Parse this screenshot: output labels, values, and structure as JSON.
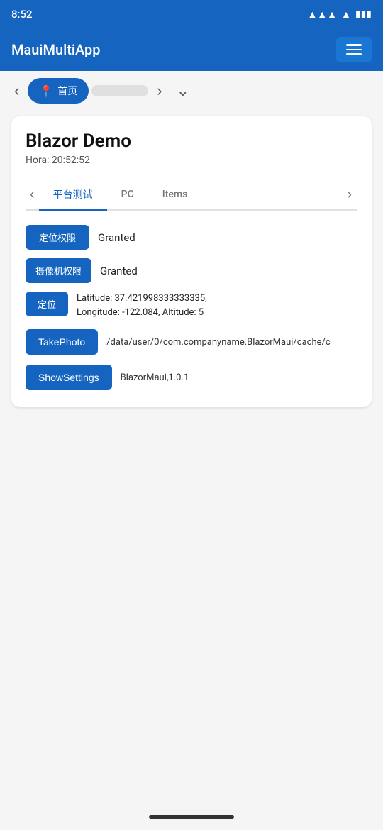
{
  "statusBar": {
    "time": "8:52",
    "wifiIcon": "📶",
    "signalIcon": "▲",
    "batteryIcon": "🔋"
  },
  "appBar": {
    "title": "MauiMultiApp",
    "menuIcon": "menu"
  },
  "tabNav": {
    "backArrow": "‹",
    "homeTab": {
      "icon": "📍",
      "label": "首页"
    },
    "blankTab": "",
    "forwardArrow": "›",
    "moreArrow": "⌄"
  },
  "page": {
    "title": "Blazor Demo",
    "subtitle": "Hora: 20:52:52"
  },
  "innerTabs": {
    "backArrow": "‹",
    "tabs": [
      {
        "label": "平台测试",
        "active": true
      },
      {
        "label": "PC",
        "active": false
      },
      {
        "label": "Items",
        "active": false
      }
    ],
    "moreArrow": "›"
  },
  "permissions": [
    {
      "badge": "定位权限",
      "status": "Granted"
    },
    {
      "badge": "摄像机权限",
      "status": "Granted"
    }
  ],
  "location": {
    "badge": "定位",
    "lat": "Latitude: 37.421998333333335,",
    "details": "Longitude: -122.084, Altitude: 5"
  },
  "actions": [
    {
      "button": "TakePhoto",
      "text": "/data/user/0/com.companyname.BlazorMaui/cache/c"
    },
    {
      "button": "ShowSettings",
      "text": "BlazorMaui,1.0.1"
    }
  ]
}
